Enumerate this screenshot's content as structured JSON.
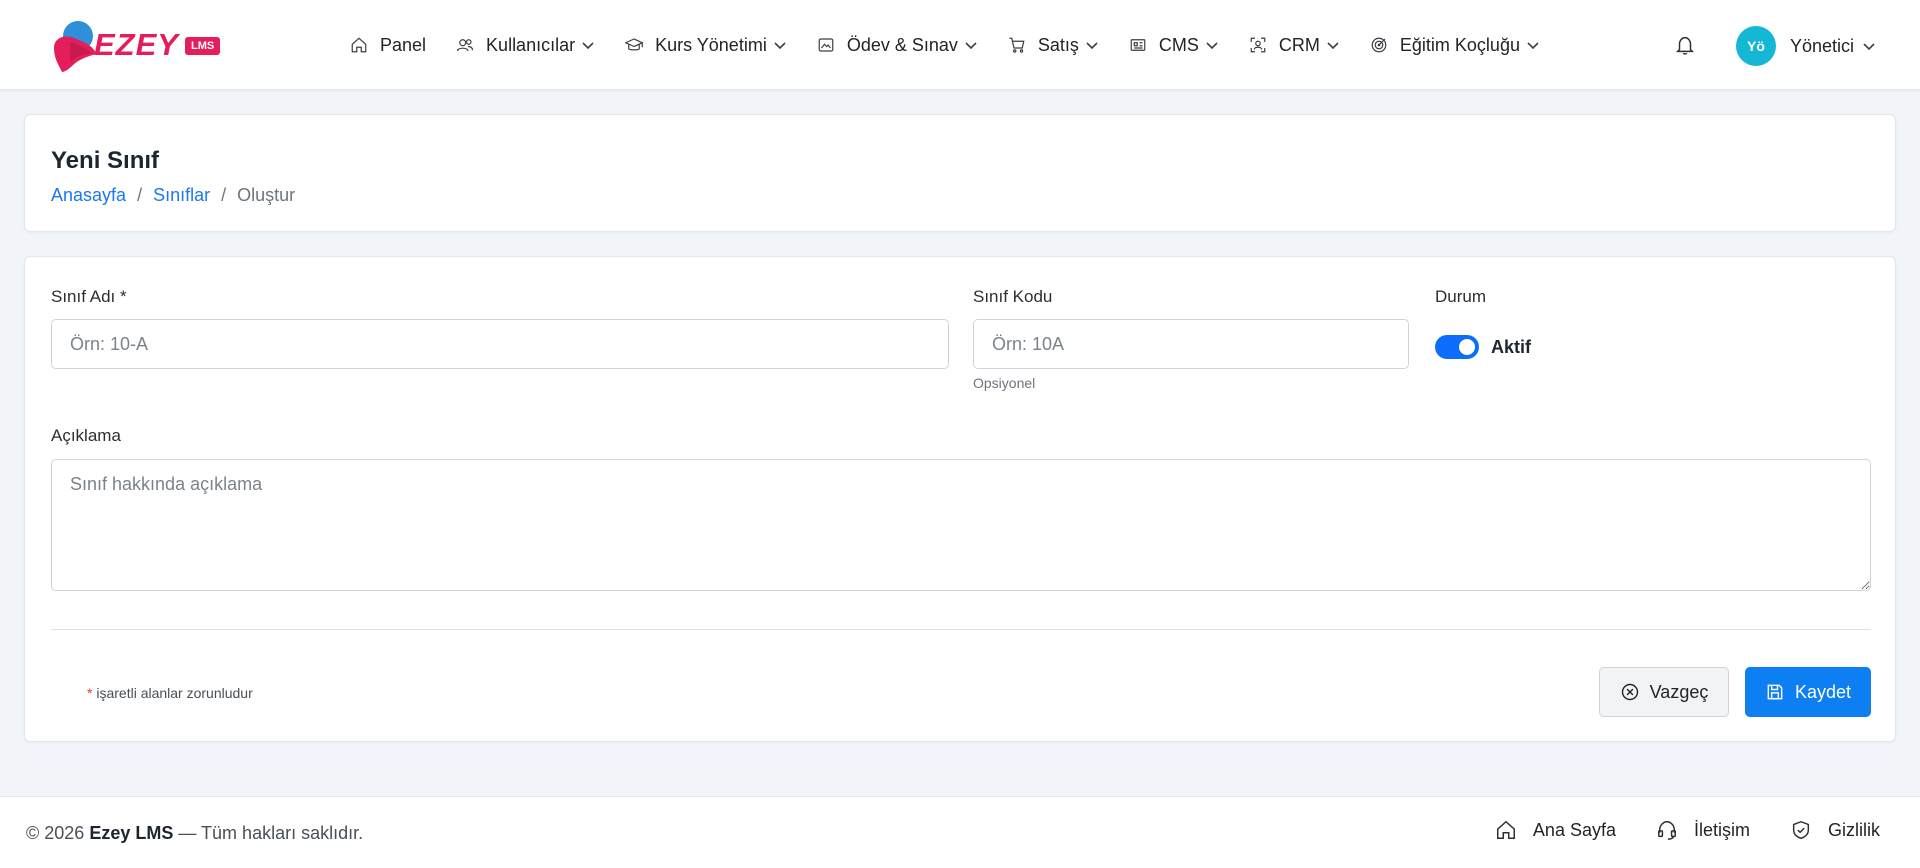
{
  "brand": {
    "name": "EZEY",
    "badge": "LMS"
  },
  "nav": {
    "items": [
      {
        "label": "Panel",
        "icon": "home-icon",
        "dropdown": false
      },
      {
        "label": "Kullanıcılar",
        "icon": "users-icon",
        "dropdown": true
      },
      {
        "label": "Kurs Yönetimi",
        "icon": "graduation-cap-icon",
        "dropdown": true
      },
      {
        "label": "Ödev & Sınav",
        "icon": "image-chart-icon",
        "dropdown": true
      },
      {
        "label": "Satış",
        "icon": "cart-icon",
        "dropdown": true
      },
      {
        "label": "CMS",
        "icon": "newspaper-icon",
        "dropdown": true
      },
      {
        "label": "CRM",
        "icon": "person-focus-icon",
        "dropdown": true
      },
      {
        "label": "Eğitim Koçluğu",
        "icon": "target-icon",
        "dropdown": true
      }
    ]
  },
  "user": {
    "initials": "Yö",
    "name": "Yönetici"
  },
  "page": {
    "title": "Yeni Sınıf",
    "breadcrumb": {
      "home": "Anasayfa",
      "section": "Sınıflar",
      "current": "Oluştur",
      "separator": "/"
    }
  },
  "form": {
    "name": {
      "label": "Sınıf Adı *",
      "placeholder": "Örn: 10-A",
      "value": ""
    },
    "code": {
      "label": "Sınıf Kodu",
      "placeholder": "Örn: 10A",
      "value": "",
      "hint": "Opsiyonel"
    },
    "status": {
      "label": "Durum",
      "toggle_label": "Aktif",
      "enabled": true
    },
    "description": {
      "label": "Açıklama",
      "placeholder": "Sınıf hakkında açıklama",
      "value": ""
    },
    "required_note": {
      "star": "*",
      "text": "işaretli alanlar zorunludur"
    },
    "cancel_label": "Vazgeç",
    "save_label": "Kaydet"
  },
  "footer": {
    "copyright_prefix": "© 2026",
    "brand": "Ezey LMS",
    "copyright_suffix": "— Tüm hakları saklıdır.",
    "links": [
      {
        "label": "Ana Sayfa",
        "icon": "home-icon"
      },
      {
        "label": "İletişim",
        "icon": "headset-icon"
      },
      {
        "label": "Gizlilik",
        "icon": "shield-check-icon"
      }
    ]
  },
  "colors": {
    "primary": "#0d7ff2",
    "brand": "#e41e5a",
    "avatar": "#14b8d4",
    "background": "#f1f4f8"
  }
}
